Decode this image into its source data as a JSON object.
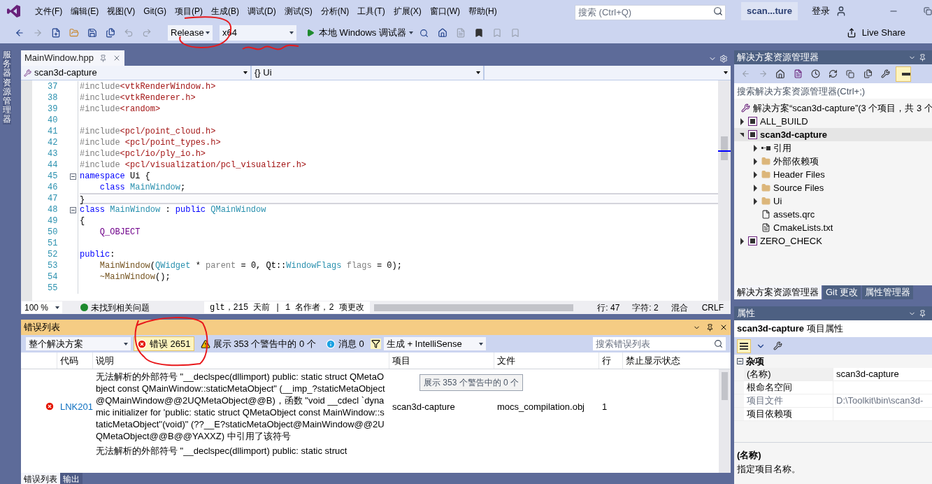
{
  "menu": [
    "文件(F)",
    "编辑(E)",
    "视图(V)",
    "Git(G)",
    "项目(P)",
    "生成(B)",
    "调试(D)",
    "测试(S)",
    "分析(N)",
    "工具(T)",
    "扩展(X)",
    "窗口(W)",
    "帮助(H)"
  ],
  "search": {
    "placeholder": "搜索 (Ctrl+Q)"
  },
  "solution_badge": "scan...ture",
  "login": "登录",
  "toolbar": {
    "configuration": "Release",
    "platform": "x64",
    "run": "本地 Windows 调试器",
    "live_share": "Live Share"
  },
  "left_strip": "服务器资源管理器",
  "editor": {
    "tabs": [
      {
        "label": "MainWindow.hpp",
        "selected": true
      }
    ],
    "project_dropdown": "scan3d-capture",
    "scope_dropdown": "{} Ui",
    "lines": [
      {
        "number": "37",
        "fold": false,
        "current": false,
        "tokens": [
          {
            "kind": "pre",
            "text": "#include"
          },
          {
            "kind": "str",
            "text": "<vtkRenderWindow.h>"
          }
        ]
      },
      {
        "number": "38",
        "fold": false,
        "current": false,
        "tokens": [
          {
            "kind": "pre",
            "text": "#include"
          },
          {
            "kind": "str",
            "text": "<vtkRenderer.h>"
          }
        ]
      },
      {
        "number": "39",
        "fold": false,
        "current": false,
        "tokens": [
          {
            "kind": "pre",
            "text": "#include"
          },
          {
            "kind": "str",
            "text": "<random>"
          }
        ]
      },
      {
        "number": "40",
        "fold": false,
        "current": false
      },
      {
        "number": "41",
        "fold": false,
        "current": false,
        "tokens": [
          {
            "kind": "pre",
            "text": "#include"
          },
          {
            "kind": "str",
            "text": "<pcl/point_cloud.h>"
          }
        ]
      },
      {
        "number": "42",
        "fold": false,
        "current": false,
        "tokens": [
          {
            "kind": "pre",
            "text": "#include "
          },
          {
            "kind": "str",
            "text": "<pcl/point_types.h>"
          }
        ]
      },
      {
        "number": "43",
        "fold": false,
        "current": false,
        "tokens": [
          {
            "kind": "pre",
            "text": "#include"
          },
          {
            "kind": "str",
            "text": "<pcl/io/ply_io.h>"
          }
        ]
      },
      {
        "number": "44",
        "fold": false,
        "current": false,
        "tokens": [
          {
            "kind": "pre",
            "text": "#include "
          },
          {
            "kind": "str",
            "text": "<pcl/visualization/pcl_visualizer.h>"
          }
        ]
      },
      {
        "number": "45",
        "fold": true,
        "current": false,
        "tokens": [
          {
            "kind": "kw",
            "text": "namespace"
          },
          {
            "kind": "plain",
            "text": " Ui {"
          }
        ]
      },
      {
        "number": "46",
        "fold": false,
        "current": false,
        "tokens": [
          {
            "kind": "kw",
            "text": "    class"
          },
          {
            "kind": "type",
            "text": " MainWindow"
          },
          {
            "kind": "plain",
            "text": ";"
          }
        ]
      },
      {
        "number": "47",
        "fold": false,
        "current": true,
        "tokens": [
          {
            "kind": "plain",
            "text": "}"
          }
        ]
      },
      {
        "number": "48",
        "fold": true,
        "current": false,
        "tokens": [
          {
            "kind": "kw",
            "text": "class"
          },
          {
            "kind": "type",
            "text": " MainWindow"
          },
          {
            "kind": "plain",
            "text": " :"
          },
          {
            "kind": "kw",
            "text": " public"
          },
          {
            "kind": "type",
            "text": " QMainWindow"
          }
        ]
      },
      {
        "number": "49",
        "fold": false,
        "current": false,
        "tokens": [
          {
            "kind": "plain",
            "text": "{"
          }
        ]
      },
      {
        "number": "50",
        "fold": false,
        "current": false,
        "tokens": [
          {
            "kind": "macro",
            "text": "    Q_OBJECT"
          }
        ]
      },
      {
        "number": "51",
        "fold": false,
        "current": false
      },
      {
        "number": "52",
        "fold": false,
        "current": false,
        "tokens": [
          {
            "kind": "kw",
            "text": "public"
          },
          {
            "kind": "plain",
            "text": ":"
          }
        ]
      },
      {
        "number": "53",
        "fold": false,
        "current": false,
        "tokens": [
          {
            "kind": "fn",
            "text": "    MainWindow"
          },
          {
            "kind": "plain",
            "text": "("
          },
          {
            "kind": "type",
            "text": "QWidget"
          },
          {
            "kind": "plain",
            "text": " * "
          },
          {
            "kind": "param",
            "text": "parent"
          },
          {
            "kind": "plain",
            "text": " = 0, Qt::"
          },
          {
            "kind": "type",
            "text": "WindowFlags"
          },
          {
            "kind": "param",
            "text": " flags"
          },
          {
            "kind": "plain",
            "text": " = 0);"
          }
        ]
      },
      {
        "number": "54",
        "fold": false,
        "current": false,
        "tokens": [
          {
            "kind": "fn",
            "text": "    ~MainWindow"
          },
          {
            "kind": "plain",
            "text": "();"
          }
        ]
      },
      {
        "number": "55",
        "fold": false,
        "current": false
      }
    ],
    "zoom": "100 %",
    "issues": "未找到相关问题",
    "codelens": "glt，215 天前 | 1 名作者，2 项更改",
    "line": "行: 47",
    "column": "字符: 2",
    "indent": "混合",
    "eol": "CRLF"
  },
  "error_list": {
    "title": "错误列表",
    "scope": "整个解决方案",
    "filters": [
      {
        "kind": "error",
        "label": "错误 2651",
        "selected": true
      },
      {
        "kind": "warning",
        "label": "展示 353 个警告中的 0 个",
        "selected": false
      },
      {
        "kind": "info",
        "label": "消息 0",
        "selected": false
      }
    ],
    "source": "生成 + IntelliSense",
    "search": {
      "placeholder": "搜索错误列表"
    },
    "columns": [
      "代码",
      "说明",
      "项目",
      "文件",
      "行",
      "禁止显示状态"
    ],
    "rows": [
      {
        "kind": "error",
        "code": "LNK201",
        "description": "无法解析的外部符号 \"__declspec(dllimport) public: static struct QMetaObject const QMainWindow::staticMetaObject\" (__imp_?staticMetaObject@QMainWindow@@2UQMetaObject@@B)，函数 \"void __cdecl `dynamic initializer for 'public: static struct QMetaObject const MainWindow::staticMetaObject''(void)\" (??__E?staticMetaObject@MainWindow@@2UQMetaObject@@B@@YAXXZ) 中引用了该符号",
        "project": "scan3d-capture",
        "file": "mocs_compilation.obj",
        "line": "1"
      },
      {
        "description": "无法解析的外部符号 \"__declspec(dllimport) public: static struct"
      }
    ],
    "tooltip": "展示 353 个警告中的 0 个",
    "tabs": [
      {
        "label": "错误列表",
        "selected": true
      },
      {
        "label": "输出",
        "selected": false
      }
    ]
  },
  "solution_explorer": {
    "title": "解决方案资源管理器",
    "search": {
      "placeholder": "搜索解决方案资源管理器(Ctrl+;)"
    },
    "tree": [
      {
        "kind": "solution",
        "label": "解决方案“scan3d-capture”(3 个项目，共 3 个",
        "selected": false,
        "children": [
          {
            "kind": "project",
            "label": "ALL_BUILD",
            "expanded": false,
            "selected": false
          },
          {
            "kind": "project",
            "label": "scan3d-capture",
            "expanded": true,
            "selected": true,
            "children": [
              {
                "kind": "references",
                "label": "引用",
                "expanded": false,
                "selected": false
              },
              {
                "kind": "external",
                "label": "外部依赖项",
                "expanded": false,
                "selected": false
              },
              {
                "kind": "folder",
                "label": "Header Files",
                "expanded": false,
                "selected": false
              },
              {
                "kind": "folder",
                "label": "Source Files",
                "expanded": false,
                "selected": false
              },
              {
                "kind": "folder",
                "label": "Ui",
                "expanded": false,
                "selected": false
              },
              {
                "kind": "file",
                "label": "assets.qrc",
                "selected": false
              },
              {
                "kind": "text",
                "label": "CmakeLists.txt",
                "selected": false
              }
            ]
          },
          {
            "kind": "project",
            "label": "ZERO_CHECK",
            "expanded": false,
            "selected": false
          }
        ]
      }
    ],
    "tabs": [
      {
        "label": "解决方案资源管理器",
        "selected": true
      },
      {
        "label": "Git 更改",
        "selected": false
      },
      {
        "label": "属性管理器",
        "selected": false
      }
    ]
  },
  "properties": {
    "title": "属性",
    "object": "scan3d-capture",
    "object_type": "项目属性",
    "category": "杂项",
    "rows": [
      {
        "name": "(名称)",
        "value": "scan3d-capture",
        "disabled": false,
        "selected": true
      },
      {
        "name": "根命名空间",
        "disabled": false,
        "selected": false
      },
      {
        "name": "项目文件",
        "value": "D:\\Toolkit\\bin\\scan3d-",
        "disabled": true,
        "selected": false
      },
      {
        "name": "项目依赖项",
        "disabled": false,
        "selected": false
      }
    ],
    "description_title": "(名称)",
    "description": "指定项目名称。"
  }
}
